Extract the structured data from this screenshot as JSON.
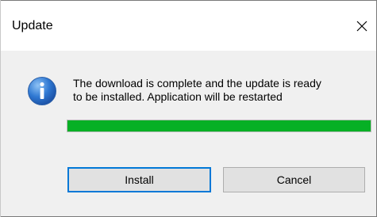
{
  "window": {
    "title": "Update"
  },
  "dialog": {
    "message_line1": "The download is complete and the update is ready",
    "message_line2": "to be installed. Application will be restarted",
    "progress": 1.0,
    "progress_color": "#06b025",
    "icon": "info-icon"
  },
  "buttons": {
    "install_label": "Install",
    "cancel_label": "Cancel"
  }
}
